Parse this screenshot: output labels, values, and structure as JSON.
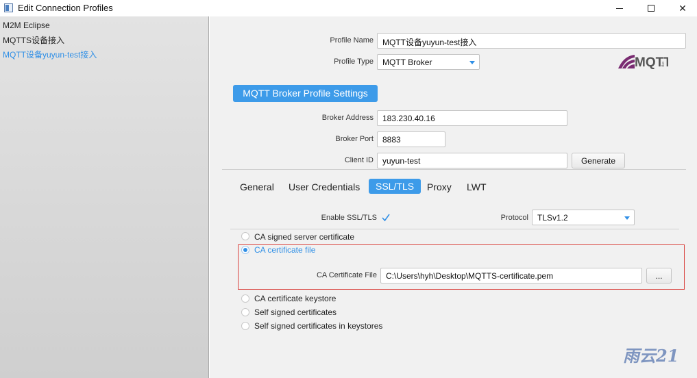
{
  "window": {
    "title": "Edit Connection Profiles",
    "minimize_icon": "minimize-icon",
    "maximize_icon": "maximize-icon",
    "close_symbol": "✕"
  },
  "sidebar": {
    "items": [
      {
        "label": "M2M Eclipse",
        "active": false
      },
      {
        "label": "MQTTS设备接入",
        "active": false
      },
      {
        "label": "MQTT设备yuyun-test接入",
        "active": true
      }
    ]
  },
  "profile": {
    "name_label": "Profile Name",
    "name_value": "MQTT设备yuyun-test接入",
    "type_label": "Profile Type",
    "type_value": "MQTT Broker",
    "logo_text": "MQTT",
    "logo_sub": "org"
  },
  "broker": {
    "section_title": "MQTT Broker Profile Settings",
    "address_label": "Broker Address",
    "address_value": "183.230.40.16",
    "port_label": "Broker Port",
    "port_value": "8883",
    "client_id_label": "Client ID",
    "client_id_value": "yuyun-test",
    "generate_label": "Generate"
  },
  "tabs": [
    {
      "label": "General",
      "active": false
    },
    {
      "label": "User Credentials",
      "active": false
    },
    {
      "label": "SSL/TLS",
      "active": true
    },
    {
      "label": "Proxy",
      "active": false
    },
    {
      "label": "LWT",
      "active": false
    }
  ],
  "ssl": {
    "enable_label": "Enable SSL/TLS",
    "enabled": true,
    "protocol_label": "Protocol",
    "protocol_value": "TLSv1.2",
    "options": [
      {
        "label": "CA signed server certificate",
        "checked": false
      },
      {
        "label": "CA certificate file",
        "checked": true
      },
      {
        "label": "CA certificate keystore",
        "checked": false
      },
      {
        "label": "Self signed certificates",
        "checked": false
      },
      {
        "label": "Self signed certificates in keystores",
        "checked": false
      }
    ],
    "ca_file_label": "CA Certificate File",
    "ca_file_value": "C:\\Users\\hyh\\Desktop\\MQTTS-certificate.pem",
    "browse_label": "..."
  },
  "watermark": "雨云21",
  "colors": {
    "accent": "#3d9be9",
    "selected_text": "#2f8fe6",
    "highlight_border": "#d9403b"
  }
}
